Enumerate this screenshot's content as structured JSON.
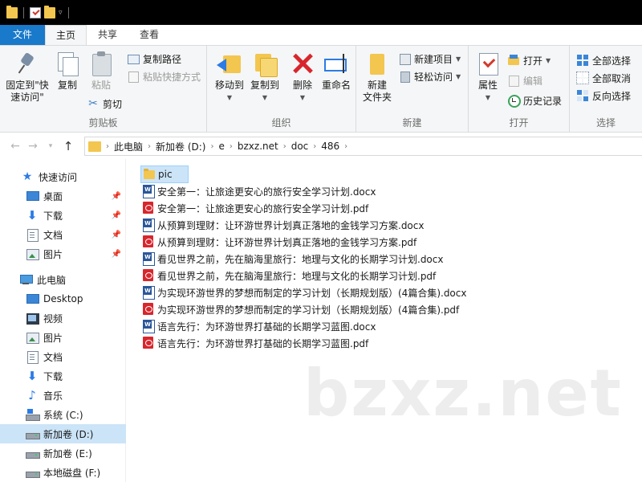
{
  "ribbon_tabs": {
    "file": "文件",
    "home": "主页",
    "share": "共享",
    "view": "查看"
  },
  "ribbon": {
    "clipboard": {
      "label": "剪贴板",
      "pin_quick_access": "固定到\"快\n速访问\"",
      "copy": "复制",
      "paste": "粘贴",
      "copy_path": "复制路径",
      "paste_shortcut": "粘贴快捷方式",
      "cut": "剪切"
    },
    "organize": {
      "label": "组织",
      "move_to": "移动到",
      "copy_to": "复制到",
      "delete": "删除",
      "rename": "重命名"
    },
    "new": {
      "label": "新建",
      "new_folder": "新建\n文件夹",
      "new_item": "新建项目",
      "easy_access": "轻松访问"
    },
    "open": {
      "label": "打开",
      "properties": "属性",
      "open": "打开",
      "edit": "编辑",
      "history": "历史记录"
    },
    "select": {
      "label": "选择",
      "select_all": "全部选择",
      "select_none": "全部取消",
      "invert": "反向选择"
    }
  },
  "address": {
    "crumbs": [
      "此电脑",
      "新加卷 (D:)",
      "e",
      "bzxz.net",
      "doc",
      "486"
    ]
  },
  "nav": {
    "quick_access": "快速访问",
    "desktop": "桌面",
    "downloads": "下载",
    "documents": "文档",
    "pictures": "图片",
    "this_pc": "此电脑",
    "pc_desktop": "Desktop",
    "videos": "视频",
    "pc_pictures": "图片",
    "pc_documents": "文档",
    "pc_downloads": "下载",
    "music": "音乐",
    "drive_c": "系统 (C:)",
    "drive_d": "新加卷 (D:)",
    "drive_e": "新加卷 (E:)",
    "drive_f": "本地磁盘 (F:)"
  },
  "files": [
    {
      "name": "pic",
      "type": "folder"
    },
    {
      "name": "安全第一：让旅途更安心的旅行安全学习计划.docx",
      "type": "docx"
    },
    {
      "name": "安全第一：让旅途更安心的旅行安全学习计划.pdf",
      "type": "pdf"
    },
    {
      "name": "从预算到理财：让环游世界计划真正落地的金钱学习方案.docx",
      "type": "docx"
    },
    {
      "name": "从预算到理财：让环游世界计划真正落地的金钱学习方案.pdf",
      "type": "pdf"
    },
    {
      "name": "看见世界之前，先在脑海里旅行：地理与文化的长期学习计划.docx",
      "type": "docx"
    },
    {
      "name": "看见世界之前，先在脑海里旅行：地理与文化的长期学习计划.pdf",
      "type": "pdf"
    },
    {
      "name": "为实现环游世界的梦想而制定的学习计划（长期规划版）(4篇合集).docx",
      "type": "docx"
    },
    {
      "name": "为实现环游世界的梦想而制定的学习计划（长期规划版）(4篇合集).pdf",
      "type": "pdf"
    },
    {
      "name": "语言先行：为环游世界打基础的长期学习蓝图.docx",
      "type": "docx"
    },
    {
      "name": "语言先行：为环游世界打基础的长期学习蓝图.pdf",
      "type": "pdf"
    }
  ],
  "watermark": "bzxz.net",
  "colors": {
    "file_tab": "#1979ca",
    "selection": "#cce4f7",
    "ribbon_bg": "#f5f6f7",
    "titlebar": "#000000"
  }
}
